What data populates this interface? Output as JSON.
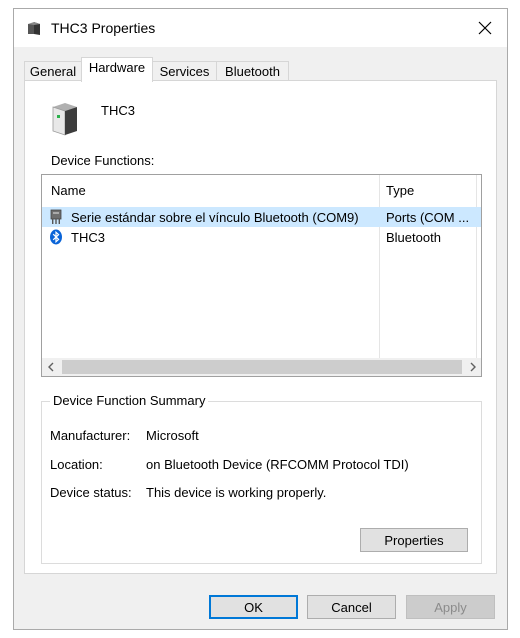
{
  "window": {
    "title": "THC3 Properties"
  },
  "tabs": [
    {
      "label": "General"
    },
    {
      "label": "Hardware"
    },
    {
      "label": "Services"
    },
    {
      "label": "Bluetooth"
    }
  ],
  "device": {
    "name": "THC3"
  },
  "functions": {
    "section_label": "Device Functions:",
    "columns": {
      "name": "Name",
      "type": "Type"
    },
    "rows": [
      {
        "name": "Serie estándar sobre el vínculo Bluetooth (COM9)",
        "type": "Ports (COM ...",
        "icon": "port-icon"
      },
      {
        "name": "THC3",
        "type": "Bluetooth",
        "icon": "bluetooth-icon"
      }
    ]
  },
  "summary": {
    "title": "Device Function Summary",
    "manufacturer_label": "Manufacturer:",
    "manufacturer": "Microsoft",
    "location_label": "Location:",
    "location": "on Bluetooth Device (RFCOMM Protocol TDI)",
    "status_label": "Device status:",
    "status": "This device is working properly.",
    "properties_button": "Properties"
  },
  "buttons": {
    "ok": "OK",
    "cancel": "Cancel",
    "apply": "Apply"
  },
  "colors": {
    "selection": "#cce8ff",
    "default_button_border": "#0078d7",
    "bluetooth": "#0a64d8"
  }
}
